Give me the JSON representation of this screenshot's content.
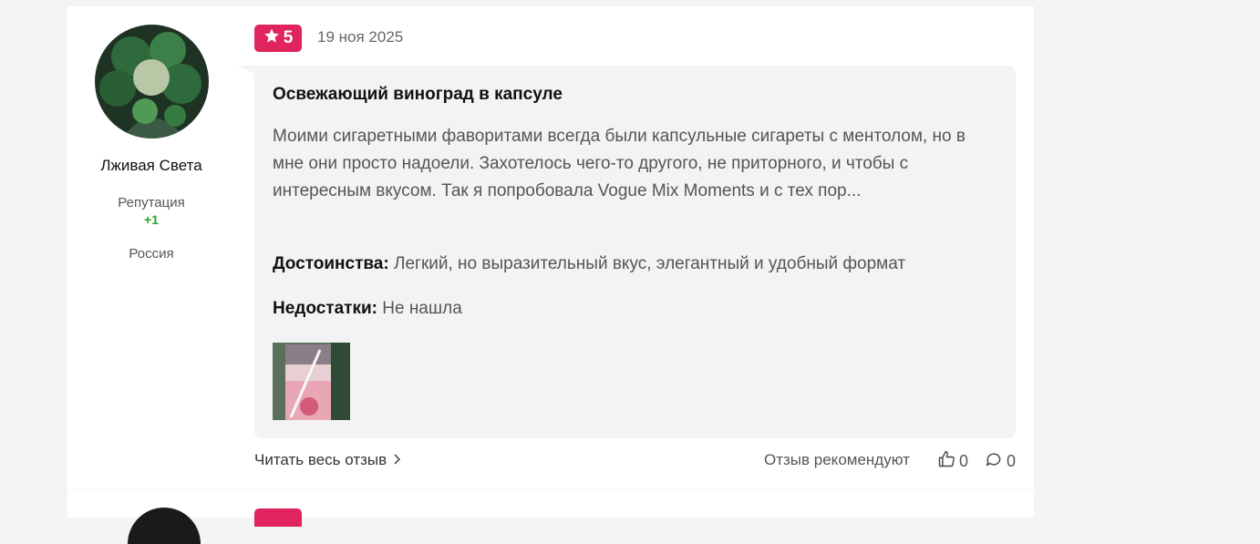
{
  "review": {
    "author": {
      "name": "Лживая Света",
      "reputation_label": "Репутация",
      "reputation_value": "+1",
      "country": "Россия"
    },
    "rating": "5",
    "date": "19 ноя 2025",
    "title": "Освежающий виноград в капсуле",
    "body": "Моими сигаретными фаворитами всегда были капсульные сигареты с ментолом, но в мне они просто надоели. Захотелось чего-то другого, не приторного, и чтобы с интересным вкусом. Так я попробовала Vogue Mix Moments и с тех пор...",
    "pros_label": "Достоинства:",
    "pros_text": "Легкий, но выразительный вкус, элегантный и удобный формат",
    "cons_label": "Недостатки:",
    "cons_text": "Не нашла",
    "read_full_label": "Читать весь отзыв",
    "recommend_label": "Отзыв рекомендуют",
    "likes_count": "0",
    "comments_count": "0"
  },
  "colors": {
    "badge": "#e0245e",
    "reputation": "#2aa52a",
    "bubble": "#f3f3f5"
  }
}
